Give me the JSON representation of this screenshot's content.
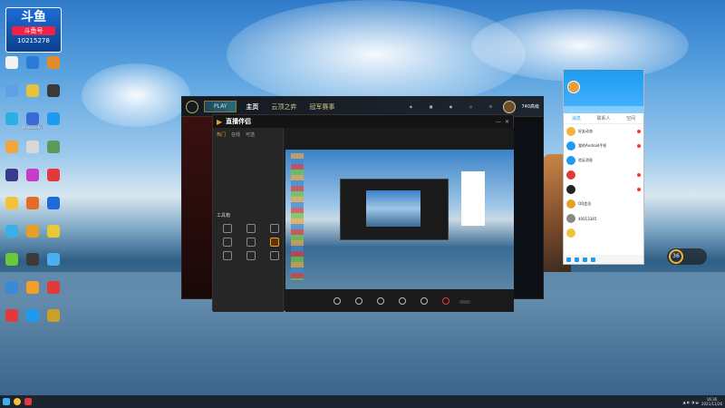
{
  "desktop_badge": {
    "line1": "斗鱼",
    "line2": "斗鱼号",
    "room": "10215278"
  },
  "desktop_icons": [
    {
      "label": "",
      "color": "#f2f2f2"
    },
    {
      "label": "",
      "color": "#2a7ad6"
    },
    {
      "label": "",
      "color": "#e28b2a"
    },
    {
      "label": "",
      "color": "#5fa0e6"
    },
    {
      "label": "",
      "color": "#e6c13a"
    },
    {
      "label": "",
      "color": "#3a3a3a"
    },
    {
      "label": "",
      "color": "#2bb0e0"
    },
    {
      "label": "Malwarebytes",
      "color": "#3a6ad6"
    },
    {
      "label": "",
      "color": "#1e9bf0"
    },
    {
      "label": "",
      "color": "#f2a53a"
    },
    {
      "label": "",
      "color": "#d8d8d8"
    },
    {
      "label": "",
      "color": "#5a9a5a"
    },
    {
      "label": "",
      "color": "#3a3a8a"
    },
    {
      "label": "",
      "color": "#c83ac8"
    },
    {
      "label": "",
      "color": "#e23a3a"
    },
    {
      "label": "",
      "color": "#f2c23a"
    },
    {
      "label": "",
      "color": "#e66a2a"
    },
    {
      "label": "",
      "color": "#1e6ad6"
    },
    {
      "label": "",
      "color": "#3ab0e6"
    },
    {
      "label": "",
      "color": "#e6a02a"
    },
    {
      "label": "",
      "color": "#e6c83a"
    },
    {
      "label": "",
      "color": "#6ac83a"
    },
    {
      "label": "",
      "color": "#3a3a3a"
    },
    {
      "label": "",
      "color": "#4ab0f0"
    },
    {
      "label": "",
      "color": "#3a8ad6"
    },
    {
      "label": "",
      "color": "#f2a02a"
    },
    {
      "label": "",
      "color": "#e23a3a"
    },
    {
      "label": "",
      "color": "#e23a3a"
    },
    {
      "label": "",
      "color": "#1e9bf0"
    },
    {
      "label": "",
      "color": "#c8a02a"
    }
  ],
  "game": {
    "play": "PLAY",
    "nav": [
      "主页",
      "云顶之弈",
      "冠军赛事"
    ],
    "right_icons": [
      "",
      "",
      "",
      "",
      ""
    ],
    "rank": "740高级"
  },
  "live": {
    "title": "直播伴侣",
    "version": "",
    "tabs": [
      "热门",
      "在线",
      "可选"
    ],
    "tools_title": "工具箱",
    "tools": [
      "",
      "",
      "",
      "",
      "",
      "",
      "",
      "",
      ""
    ],
    "scene_tabs": [
      "",
      "",
      ""
    ],
    "controls": [
      "",
      "",
      "",
      "",
      "",
      ""
    ],
    "start_btn": "",
    "footer_note": ""
  },
  "qq": {
    "tabs": [
      "消息",
      "联系人",
      "空间"
    ],
    "items": [
      {
        "name": "好友动态",
        "preview": "",
        "time": "",
        "color": "#f2b33a",
        "dot": true
      },
      {
        "name": "我的Android手机",
        "preview": "",
        "time": "",
        "color": "#1e9bf0",
        "dot": true
      },
      {
        "name": "验证消息",
        "preview": "",
        "time": "",
        "color": "#1e9bf0",
        "dot": false
      },
      {
        "name": "",
        "preview": "",
        "time": "",
        "color": "#e23a3a",
        "dot": true
      },
      {
        "name": "",
        "preview": "",
        "time": "",
        "color": "#222",
        "dot": true
      },
      {
        "name": "QQ会员",
        "preview": "",
        "time": "",
        "color": "#e6a02a",
        "dot": false
      },
      {
        "name": "40013345",
        "preview": "",
        "time": "",
        "color": "#888",
        "dot": false
      },
      {
        "name": "",
        "preview": "",
        "time": "",
        "color": "#f2c23a",
        "dot": false
      }
    ]
  },
  "widget": {
    "value": "36",
    "line1": "",
    "line2": ""
  },
  "taskbar": {
    "time": "16:36",
    "date": "2021/11/26"
  }
}
